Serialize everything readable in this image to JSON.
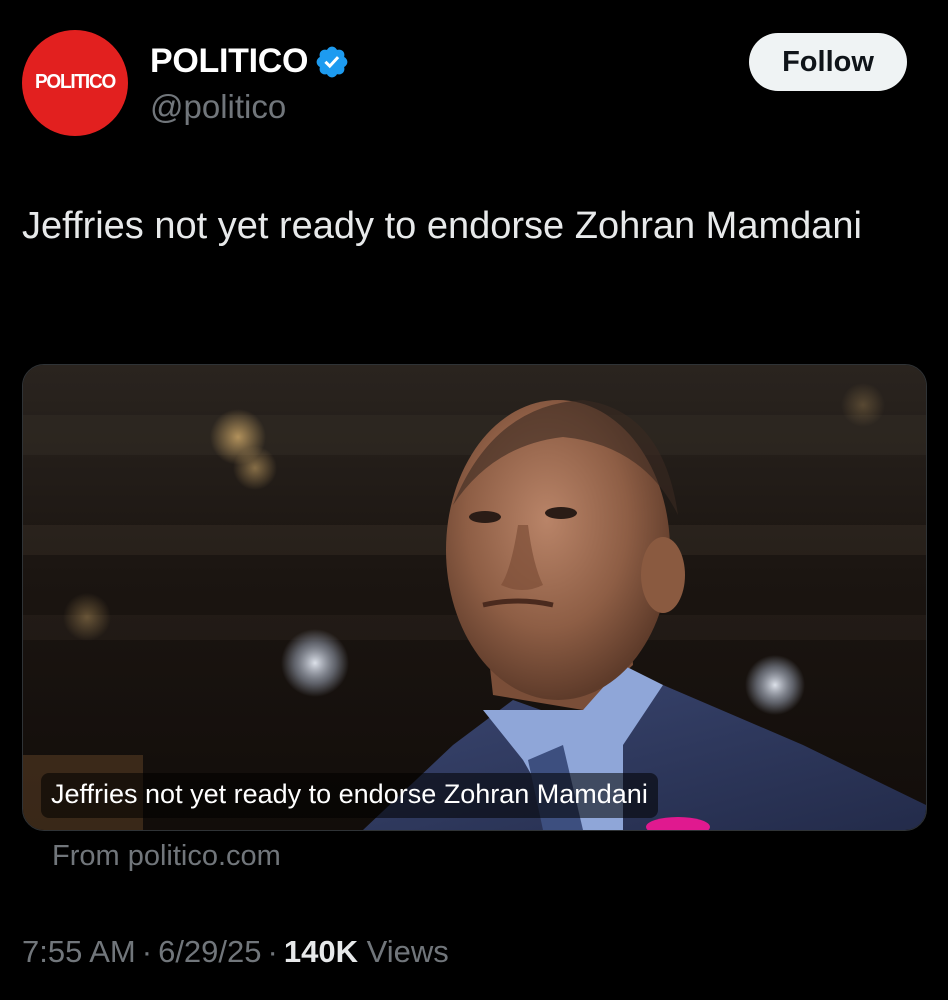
{
  "author": {
    "avatar_text": "POLITICO",
    "display_name": "POLITICO",
    "handle": "@politico",
    "verified": true,
    "verified_icon": "verified-badge-icon",
    "brand_color": "#e2201f",
    "verified_color": "#1d9bf0"
  },
  "follow_button": {
    "label": "Follow"
  },
  "tweet": {
    "text": "Jeffries not yet ready to endorse Zohran Mamdani"
  },
  "card": {
    "caption": "Jeffries not yet ready to endorse Zohran Mamdani",
    "source": "From politico.com"
  },
  "meta": {
    "time": "7:55 AM",
    "separator": "·",
    "date": "6/29/25",
    "views_count": "140K",
    "views_label": "Views"
  }
}
